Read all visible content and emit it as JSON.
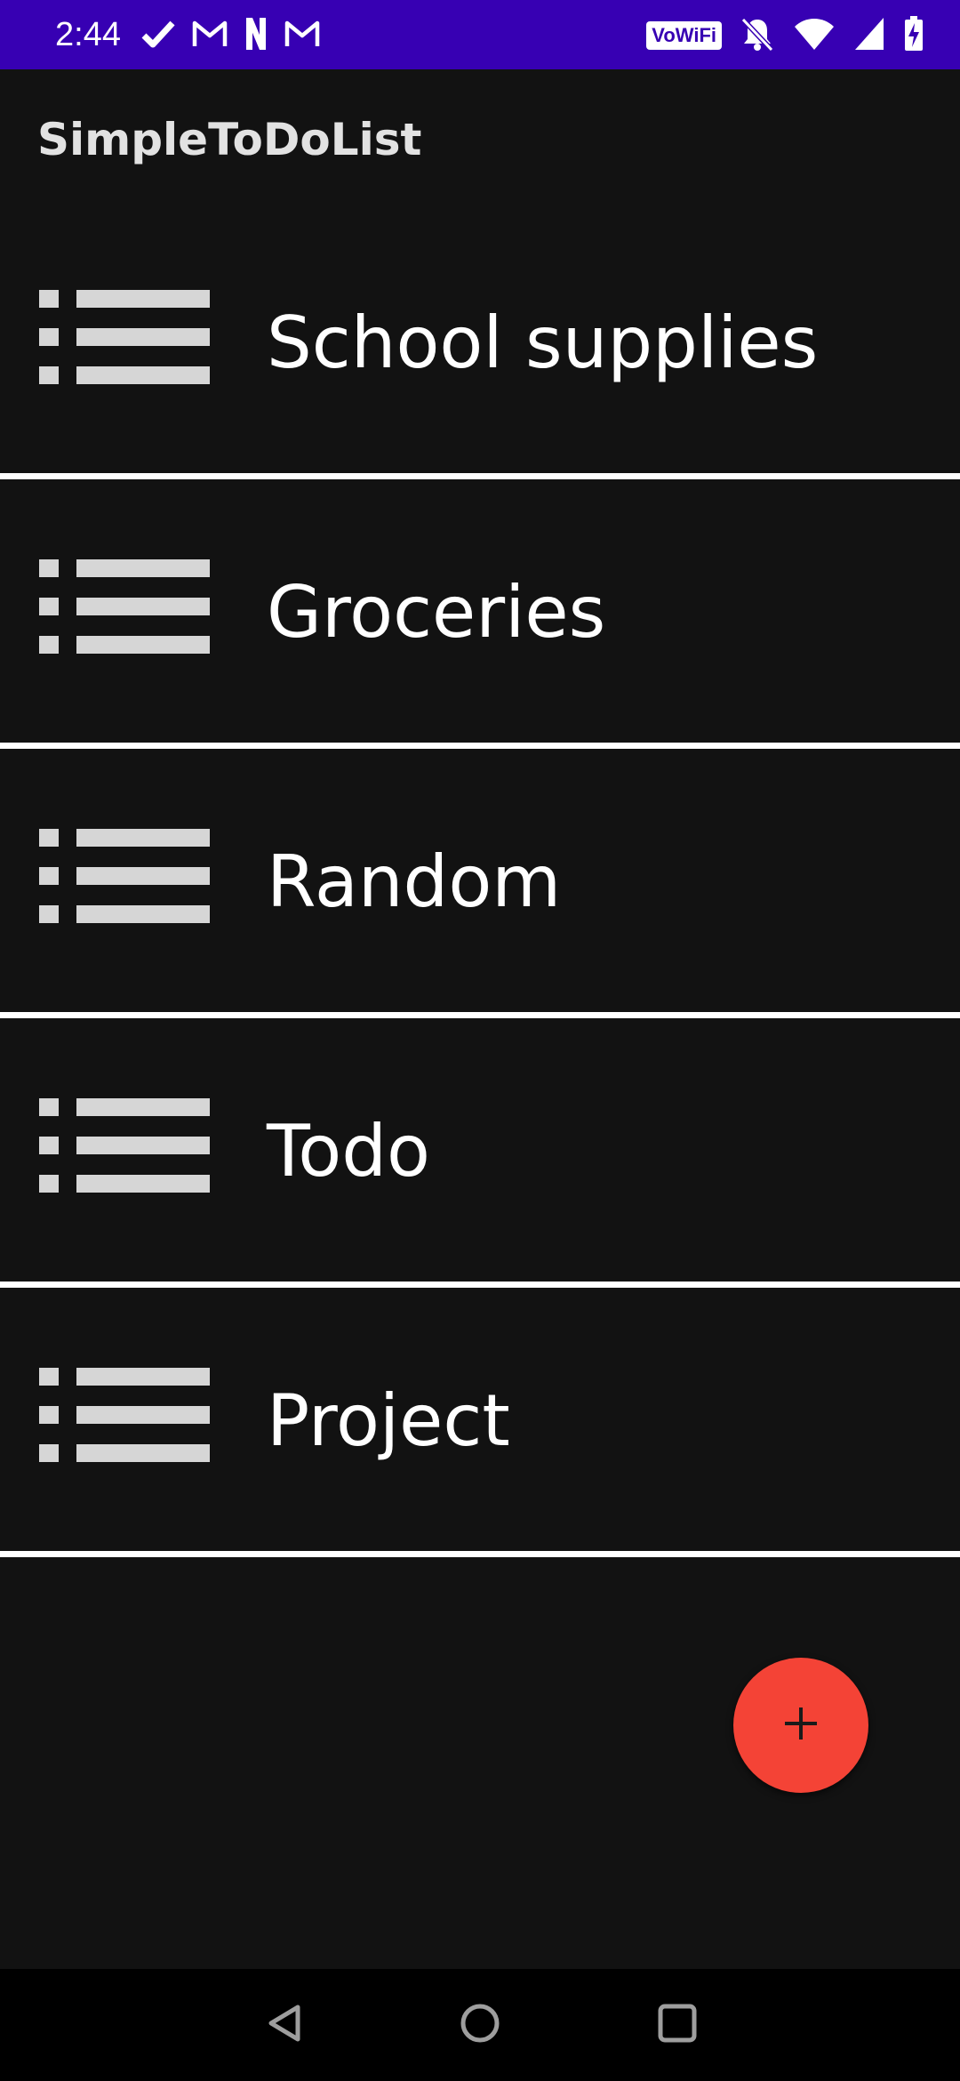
{
  "status_bar": {
    "time": "2:44",
    "left_icons": [
      "check-icon",
      "gmail-icon",
      "netflix-icon",
      "gmail-icon"
    ],
    "wifi_calling_label": "VoWiFi",
    "right_icons": [
      "wifi-calling-badge",
      "bell-off-icon",
      "wifi-icon",
      "cell-signal-icon",
      "battery-charging-icon"
    ],
    "background": "#3700b3"
  },
  "app_bar": {
    "title": "SimpleToDoList"
  },
  "lists": {
    "items": [
      {
        "label": "School supplies",
        "icon": "list-icon"
      },
      {
        "label": "Groceries",
        "icon": "list-icon"
      },
      {
        "label": "Random",
        "icon": "list-icon"
      },
      {
        "label": "Todo",
        "icon": "list-icon"
      },
      {
        "label": "Project",
        "icon": "list-icon"
      }
    ]
  },
  "fab": {
    "icon": "plus-icon",
    "color": "#f44336"
  },
  "nav_bar": {
    "buttons": [
      "back-icon",
      "home-icon",
      "recents-icon"
    ]
  },
  "colors": {
    "background": "#121212",
    "divider": "#ffffff",
    "icon": "#d6d6d6",
    "text": "#ffffff"
  }
}
